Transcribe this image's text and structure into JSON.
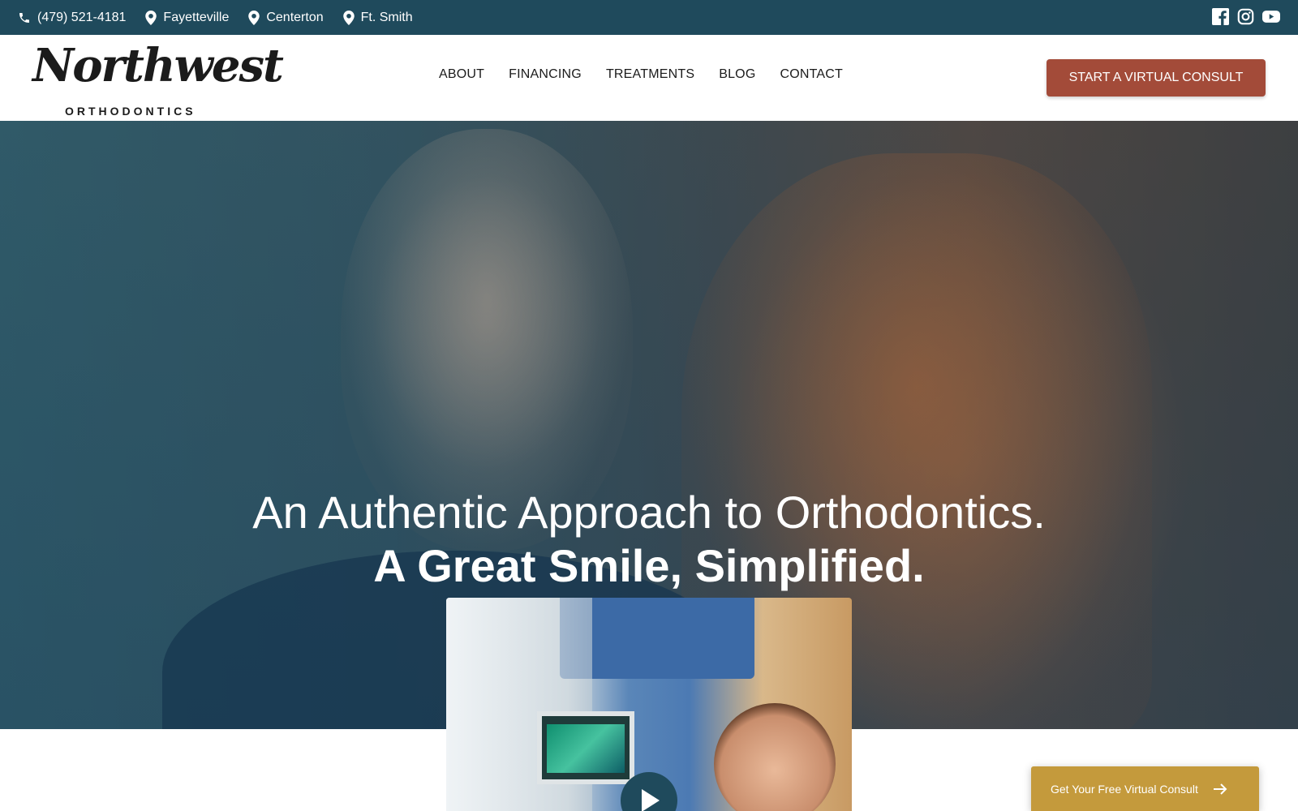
{
  "topbar": {
    "phone": "(479) 521-4181",
    "locations": [
      "Fayetteville",
      "Centerton",
      "Ft. Smith"
    ],
    "social": [
      "facebook-icon",
      "instagram-icon",
      "youtube-icon"
    ],
    "background": "#1f4a5c"
  },
  "header": {
    "logo_script": "Northwest",
    "logo_sub": "ORTHODONTICS",
    "nav": [
      "ABOUT",
      "FINANCING",
      "TREATMENTS",
      "BLOG",
      "CONTACT"
    ],
    "cta_label": "START A VIRTUAL CONSULT",
    "cta_color": "#a34b39"
  },
  "hero": {
    "line1": "An Authentic Approach to Orthodontics.",
    "line2": "A Great Smile, Simplified."
  },
  "video": {
    "play_icon": "play-icon"
  },
  "float_cta": {
    "label": "Get Your Free Virtual Consult",
    "color": "#c49a3c"
  }
}
